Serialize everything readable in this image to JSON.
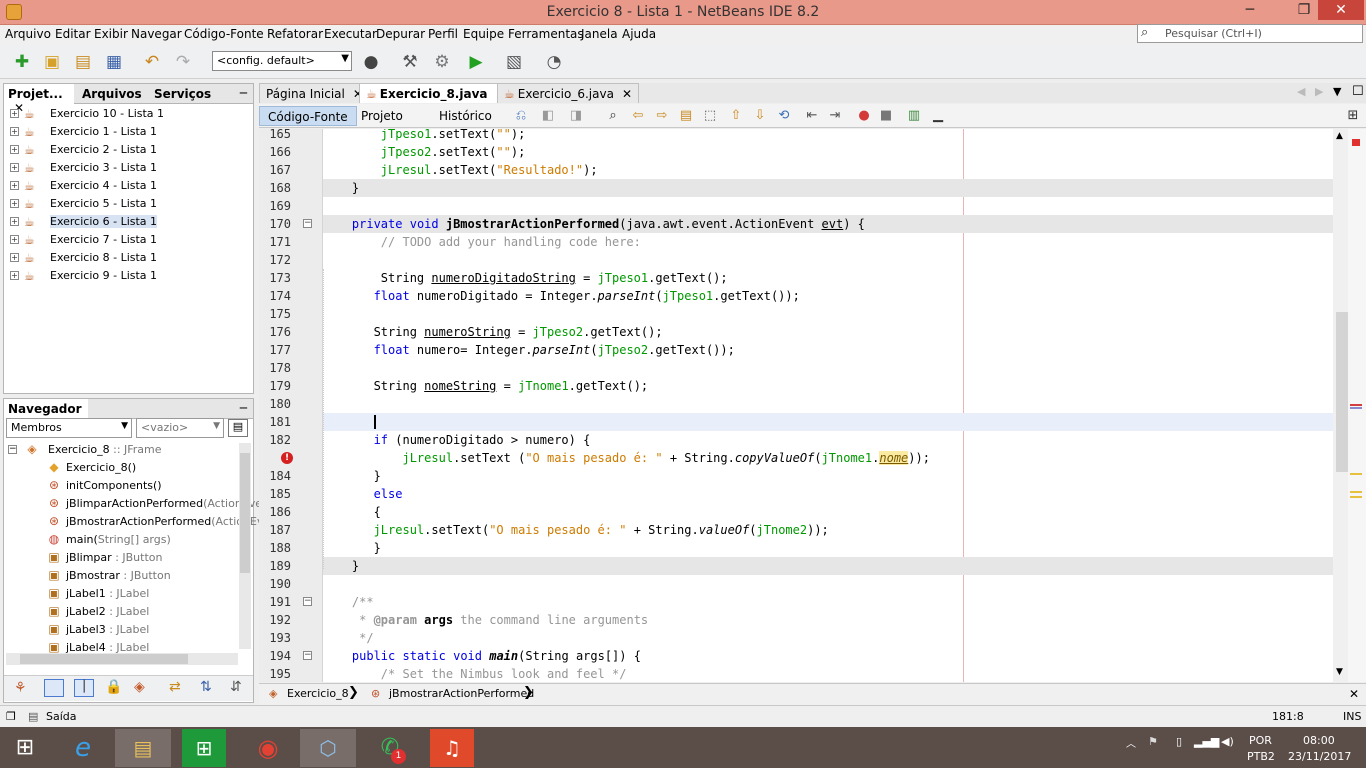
{
  "window": {
    "title": "Exercicio 8 - Lista 1 - NetBeans IDE 8.2",
    "min": "─",
    "max": "❐",
    "close": "✕"
  },
  "menu": [
    "Arquivo",
    "Editar",
    "Exibir",
    "Navegar",
    "Código-Fonte",
    "Refatorar",
    "Executar",
    "Depurar",
    "Perfil",
    "Equipe",
    "Ferramentas",
    "Janela",
    "Ajuda"
  ],
  "search": {
    "placeholder": "Pesquisar (Ctrl+I)"
  },
  "toolbar": {
    "config": "<config. default>"
  },
  "projects_panel": {
    "tabs": [
      "Projet...",
      "Arquivos",
      "Serviços"
    ],
    "close": "✕",
    "minimize": "─",
    "items": [
      "Exercicio 10 - Lista 1",
      "Exercicio 1 - Lista 1",
      "Exercicio 2 - Lista 1",
      "Exercicio 3 - Lista 1",
      "Exercicio 4 - Lista 1",
      "Exercicio 5 - Lista 1",
      "Exercicio 6 - Lista 1",
      "Exercicio 7 - Lista 1",
      "Exercicio 8 - Lista 1",
      "Exercicio 9 - Lista 1"
    ],
    "selected": "Exercicio 6 - Lista 1"
  },
  "navigator": {
    "title": "Navegador",
    "close": "✕",
    "minimize": "─",
    "filter": "Membros",
    "scope": "<vazio>",
    "root": "Exercicio_8",
    "root_type": ":: JFrame",
    "members": [
      {
        "name": "Exercicio_8()",
        "type": ""
      },
      {
        "name": "initComponents()",
        "type": ""
      },
      {
        "name": "jBlimparActionPerformed",
        "type": "(ActionEve"
      },
      {
        "name": "jBmostrarActionPerformed",
        "type": "(ActionEv"
      },
      {
        "name": "main(",
        "type": "String[] args)"
      },
      {
        "name": "jBlimpar",
        "type": ": JButton"
      },
      {
        "name": "jBmostrar",
        "type": ": JButton"
      },
      {
        "name": "jLabel1",
        "type": ": JLabel"
      },
      {
        "name": "jLabel2",
        "type": ": JLabel"
      },
      {
        "name": "jLabel3",
        "type": ": JLabel"
      },
      {
        "name": "jLabel4",
        "type": ": JLabel"
      }
    ]
  },
  "editor": {
    "tabs": [
      {
        "label": "Página Inicial",
        "close": "✕"
      },
      {
        "label": "Exercicio_8.java",
        "close": "✕"
      },
      {
        "label": "Exercicio_6.java",
        "close": "✕"
      }
    ],
    "views": [
      "Código-Fonte",
      "Projeto",
      "Histórico"
    ],
    "line_numbers": [
      "165",
      "166",
      "167",
      "168",
      "169",
      "170",
      "171",
      "172",
      "173",
      "174",
      "175",
      "176",
      "177",
      "178",
      "179",
      "180",
      "181",
      "182",
      "",
      "184",
      "185",
      "186",
      "187",
      "188",
      "189",
      "190",
      "191",
      "192",
      "193",
      "194",
      "195"
    ]
  },
  "breadcrumb": [
    "Exercicio_8",
    "jBmostrarActionPerformed"
  ],
  "status": {
    "output": "Saída",
    "position": "181:8",
    "mode": "INS"
  },
  "taskbar": {
    "lang": "POR",
    "layout": "PTB2",
    "time": "08:00",
    "date": "23/11/2017",
    "badge": "1"
  }
}
